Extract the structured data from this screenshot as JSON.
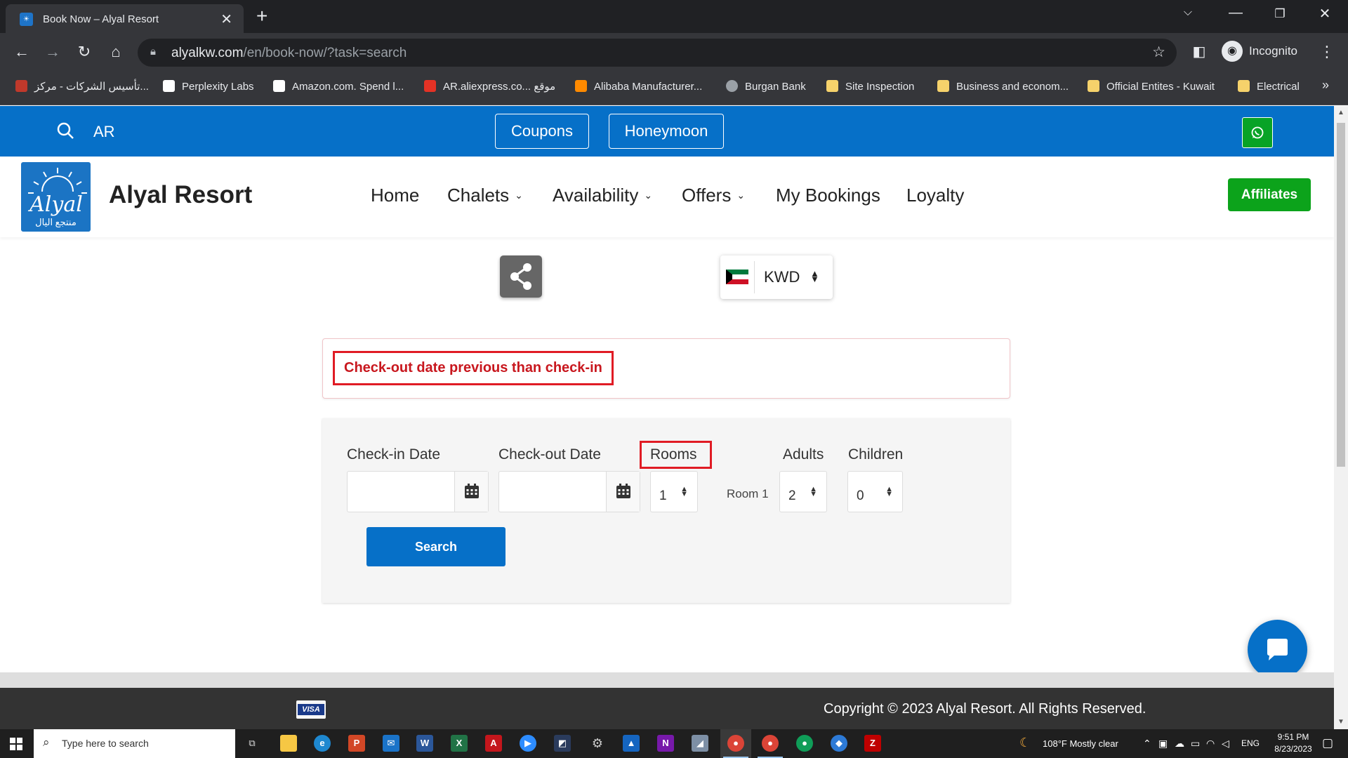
{
  "browser": {
    "tab_title": "Book Now – Alyal Resort",
    "url_host": "alyalkw.com",
    "url_path": "/en/book-now/?task=search",
    "profile_label": "Incognito",
    "bookmarks": [
      {
        "label": "تأسيس الشركات - مركز...",
        "color": "#c0392b"
      },
      {
        "label": "Perplexity Labs",
        "color": "#ffffff"
      },
      {
        "label": "Amazon.com. Spend l...",
        "color": "#ffffff"
      },
      {
        "label": "AR.aliexpress.co... موقع",
        "color": "#e43225"
      },
      {
        "label": "Alibaba Manufacturer...",
        "color": "#ff8a00"
      },
      {
        "label": "Burgan Bank",
        "color": "#9aa0a6"
      },
      {
        "label": "Site Inspection",
        "color": "#f6d26b"
      },
      {
        "label": "Business and econom...",
        "color": "#f6d26b"
      },
      {
        "label": "Official Entites - Kuwait",
        "color": "#f6d26b"
      },
      {
        "label": "Electrical",
        "color": "#f6d26b"
      }
    ],
    "more_bookmarks": "»"
  },
  "site": {
    "topbar": {
      "lang_label": "AR",
      "buttons": [
        "Coupons",
        "Honeymoon"
      ]
    },
    "brand": "Alyal Resort",
    "logo_text": "منتجع اليال",
    "menu": [
      {
        "label": "Home",
        "dropdown": false
      },
      {
        "label": "Chalets",
        "dropdown": true
      },
      {
        "label": "Availability",
        "dropdown": true
      },
      {
        "label": "Offers",
        "dropdown": true
      },
      {
        "label": "My Bookings",
        "dropdown": false
      },
      {
        "label": "Loyalty",
        "dropdown": false
      }
    ],
    "affiliates_label": "Affiliates",
    "currency": "KWD",
    "alert_text": "Check-out date previous than check-in",
    "form": {
      "checkin_label": "Check-in Date",
      "checkin_value": "",
      "checkout_label": "Check-out Date",
      "checkout_value": "",
      "rooms_label": "Rooms",
      "rooms_value": "1",
      "room_name": "Room 1",
      "adults_label": "Adults",
      "adults_value": "2",
      "children_label": "Children",
      "children_value": "0",
      "search_label": "Search"
    },
    "footer": {
      "payment_label": "VISA",
      "copyright": "Copyright © 2023 Alyal Resort. All Rights Reserved."
    }
  },
  "taskbar": {
    "search_placeholder": "Type here to search",
    "weather": "108°F  Mostly clear",
    "language": "ENG",
    "time": "9:51 PM",
    "date": "8/23/2023"
  },
  "colors": {
    "brand_blue": "#0670c8",
    "affiliate_green": "#0ca31b",
    "alert_red": "#e01b24",
    "footer_dark": "#333333"
  }
}
